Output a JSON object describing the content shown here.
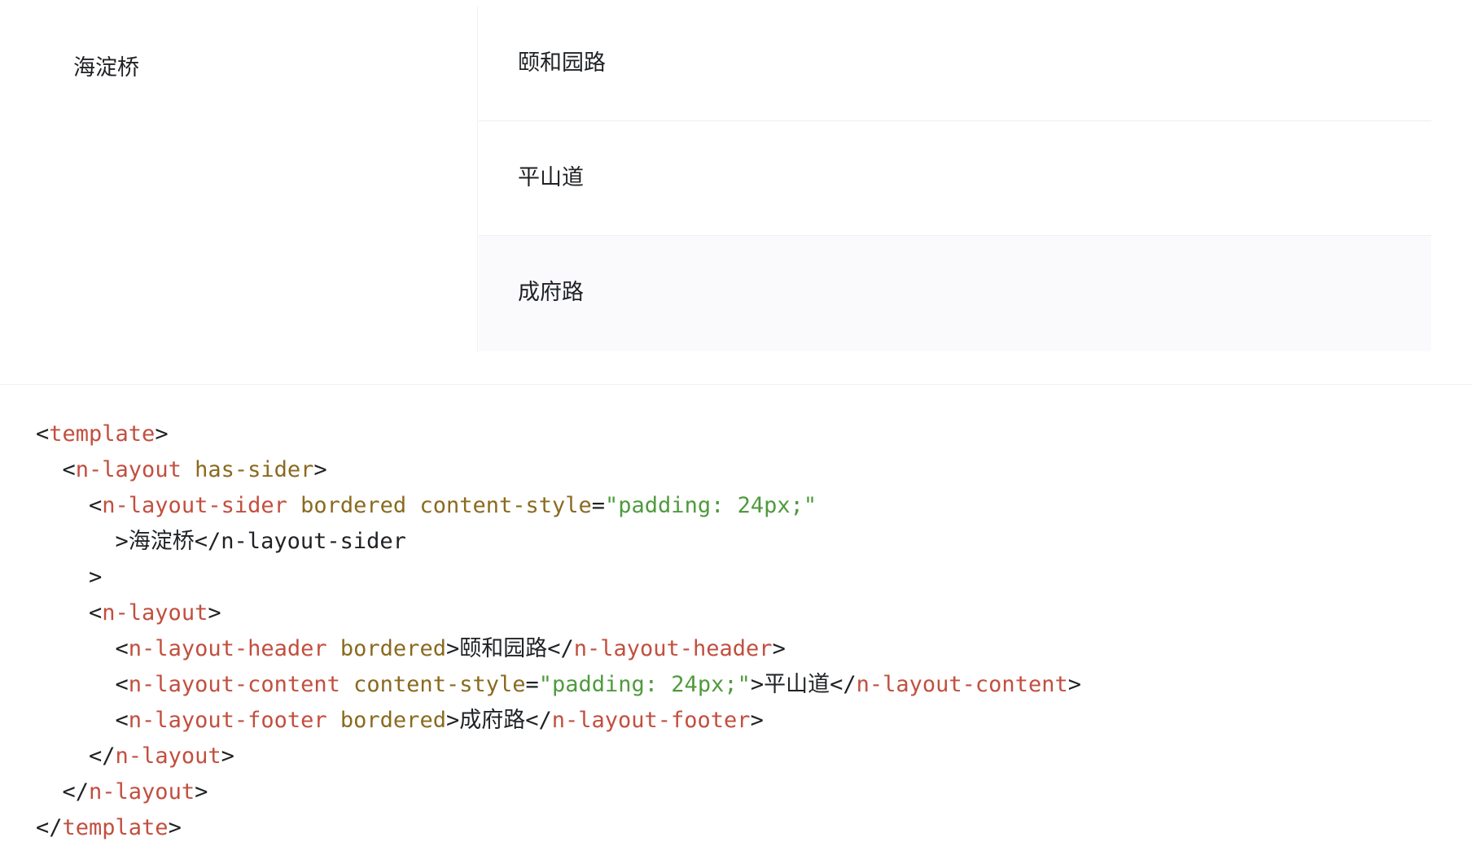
{
  "demo": {
    "sider_text": "海淀桥",
    "header_text": "颐和园路",
    "content_text": "平山道",
    "footer_text": "成府路"
  },
  "code": {
    "lines": [
      [
        {
          "t": "punct",
          "v": "<"
        },
        {
          "t": "tag",
          "v": "template"
        },
        {
          "t": "punct",
          "v": ">"
        }
      ],
      [
        {
          "t": "punct",
          "v": "  <"
        },
        {
          "t": "tag",
          "v": "n-layout"
        },
        {
          "t": "punct",
          "v": " "
        },
        {
          "t": "attr",
          "v": "has-sider"
        },
        {
          "t": "punct",
          "v": ">"
        }
      ],
      [
        {
          "t": "punct",
          "v": "    <"
        },
        {
          "t": "tag",
          "v": "n-layout-sider"
        },
        {
          "t": "punct",
          "v": " "
        },
        {
          "t": "attr",
          "v": "bordered"
        },
        {
          "t": "punct",
          "v": " "
        },
        {
          "t": "attr",
          "v": "content-style"
        },
        {
          "t": "punct",
          "v": "="
        },
        {
          "t": "str",
          "v": "\"padding: 24px;\""
        }
      ],
      [
        {
          "t": "punct",
          "v": "      >海淀桥</n-layout-sider"
        }
      ],
      [
        {
          "t": "punct",
          "v": "    >"
        }
      ],
      [
        {
          "t": "punct",
          "v": "    <"
        },
        {
          "t": "tag",
          "v": "n-layout"
        },
        {
          "t": "punct",
          "v": ">"
        }
      ],
      [
        {
          "t": "punct",
          "v": "      <"
        },
        {
          "t": "tag",
          "v": "n-layout-header"
        },
        {
          "t": "punct",
          "v": " "
        },
        {
          "t": "attr",
          "v": "bordered"
        },
        {
          "t": "punct",
          "v": ">颐和园路</"
        },
        {
          "t": "tag",
          "v": "n-layout-header"
        },
        {
          "t": "punct",
          "v": ">"
        }
      ],
      [
        {
          "t": "punct",
          "v": "      <"
        },
        {
          "t": "tag",
          "v": "n-layout-content"
        },
        {
          "t": "punct",
          "v": " "
        },
        {
          "t": "attr",
          "v": "content-style"
        },
        {
          "t": "punct",
          "v": "="
        },
        {
          "t": "str",
          "v": "\"padding: 24px;\""
        },
        {
          "t": "punct",
          "v": ">平山道</"
        },
        {
          "t": "tag",
          "v": "n-layout-content"
        },
        {
          "t": "punct",
          "v": ">"
        }
      ],
      [
        {
          "t": "punct",
          "v": "      <"
        },
        {
          "t": "tag",
          "v": "n-layout-footer"
        },
        {
          "t": "punct",
          "v": " "
        },
        {
          "t": "attr",
          "v": "bordered"
        },
        {
          "t": "punct",
          "v": ">成府路</"
        },
        {
          "t": "tag",
          "v": "n-layout-footer"
        },
        {
          "t": "punct",
          "v": ">"
        }
      ],
      [
        {
          "t": "punct",
          "v": "    </"
        },
        {
          "t": "tag",
          "v": "n-layout"
        },
        {
          "t": "punct",
          "v": ">"
        }
      ],
      [
        {
          "t": "punct",
          "v": "  </"
        },
        {
          "t": "tag",
          "v": "n-layout"
        },
        {
          "t": "punct",
          "v": ">"
        }
      ],
      [
        {
          "t": "punct",
          "v": "</"
        },
        {
          "t": "tag",
          "v": "template"
        },
        {
          "t": "punct",
          "v": ">"
        }
      ]
    ]
  },
  "colors": {
    "tag": "#c24f3f",
    "attr": "#8a6a1f",
    "string": "#4f9a3d",
    "border": "#efeff5",
    "footer_bg": "#fafafc"
  }
}
